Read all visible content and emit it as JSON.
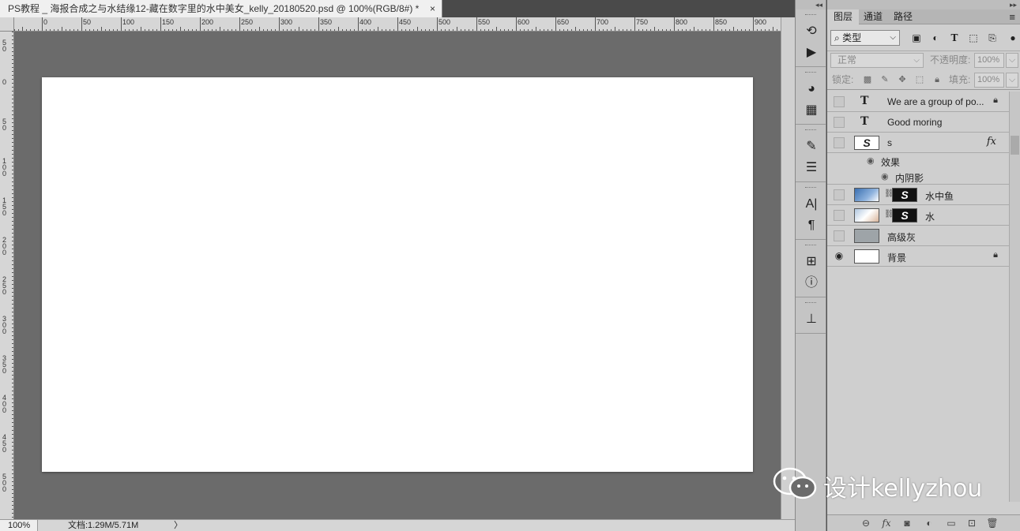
{
  "document": {
    "tab_title": "PS教程 _ 海报合成之与水结缘12-藏在数字里的水中美女_kelly_20180520.psd @ 100%(RGB/8#) *",
    "close_glyph": "×"
  },
  "rulers": {
    "top_labels": [
      "0",
      "50",
      "100",
      "150",
      "200",
      "250",
      "300",
      "350",
      "400",
      "450",
      "500",
      "550",
      "600",
      "650",
      "700",
      "750",
      "800",
      "850",
      "900"
    ],
    "left_labels": [
      "5\n0",
      "0",
      "5\n0",
      "1\n0\n0",
      "1\n5\n0",
      "2\n0\n0",
      "2\n5\n0",
      "3\n0\n0",
      "3\n5\n0",
      "4\n0\n0",
      "4\n5\n0",
      "5\n0\n0"
    ]
  },
  "status": {
    "zoom": "100%",
    "doc_info": "文档:1.29M/5.71M",
    "arrow": "〉"
  },
  "panel": {
    "tabs": [
      "图层",
      "通道",
      "路径"
    ],
    "filter_type": "类型",
    "blend_mode": "正常",
    "opacity_label": "不透明度:",
    "opacity_value": "100%",
    "lock_label": "锁定:",
    "fill_label": "填充:",
    "fill_value": "100%",
    "layers": [
      {
        "name": "We are a group of po...",
        "kind": "text",
        "locked": true
      },
      {
        "name": "Good moring",
        "kind": "text",
        "locked": false
      },
      {
        "name": "s",
        "kind": "smart",
        "fx": "fx"
      },
      {
        "name": "水中鱼",
        "kind": "masked"
      },
      {
        "name": "水",
        "kind": "masked"
      },
      {
        "name": "高级灰",
        "kind": "fill"
      },
      {
        "name": "背景",
        "kind": "background",
        "locked": true,
        "visible": true
      }
    ],
    "effects_label": "效果",
    "inner_shadow_label": "内阴影"
  },
  "watermark": {
    "text": "设计kellyzhou"
  },
  "colors": {
    "canvas_bg": "#6b6b6b",
    "document": "#ffffff",
    "panel_bg": "#cfcfcf"
  }
}
